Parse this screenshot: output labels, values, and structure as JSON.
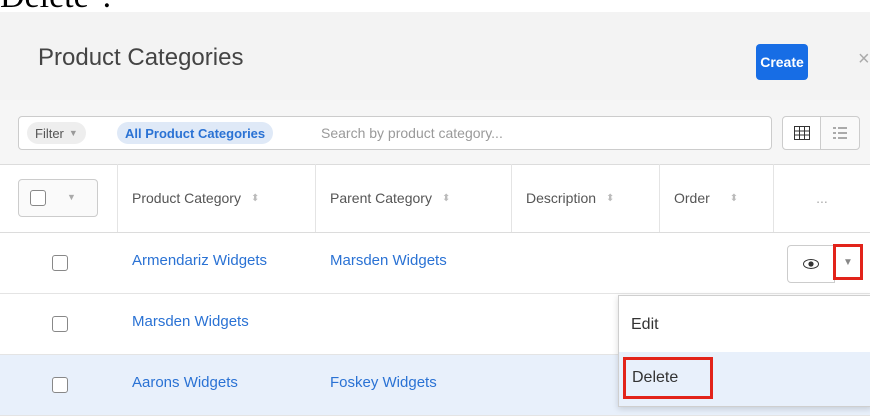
{
  "caption": "Delete\".",
  "header": {
    "title": "Product Categories",
    "create_label": "Create",
    "close_glyph": "×"
  },
  "filter": {
    "filter_label": "Filter",
    "active_filter": "All Product Categories",
    "search_placeholder": "Search by product category..."
  },
  "columns": {
    "product_category": "Product Category",
    "parent_category": "Parent Category",
    "description": "Description",
    "order": "Order",
    "actions": "..."
  },
  "rows": [
    {
      "product_category": "Armendariz Widgets",
      "parent_category": "Marsden Widgets"
    },
    {
      "product_category": "Marsden Widgets",
      "parent_category": ""
    },
    {
      "product_category": "Aarons Widgets",
      "parent_category": "Foskey Widgets"
    }
  ],
  "menu": {
    "edit": "Edit",
    "delete": "Delete"
  },
  "icons": {
    "grid": "grid-view-icon",
    "list": "list-view-icon",
    "eye": "eye-icon",
    "caret": "caret-down-icon"
  },
  "colors": {
    "accent": "#176de5",
    "link": "#2a72d4",
    "highlight": "#e8f0fb",
    "callout": "#e2231a"
  }
}
